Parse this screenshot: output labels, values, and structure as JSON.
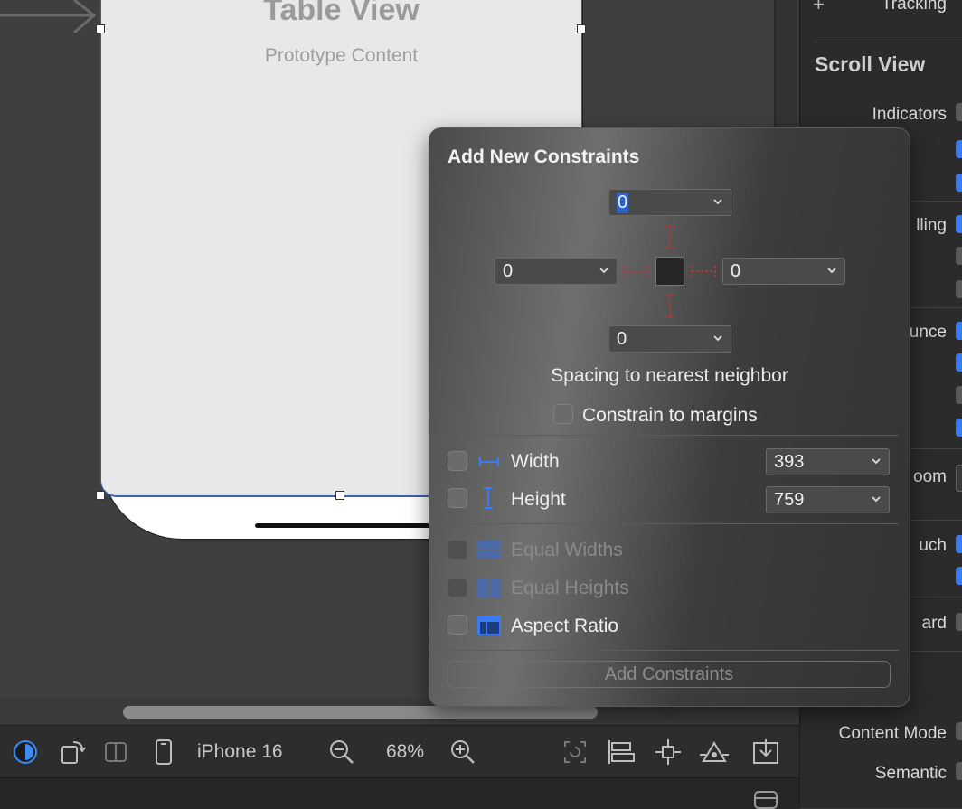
{
  "canvas": {
    "table_view_title": "Table View",
    "table_view_subtitle": "Prototype Content"
  },
  "popover": {
    "title": "Add New Constraints",
    "top_value": "0",
    "left_value": "0",
    "right_value": "0",
    "bottom_value": "0",
    "spacing_caption": "Spacing to nearest neighbor",
    "constrain_margins_label": "Constrain to margins",
    "width_label": "Width",
    "width_value": "393",
    "height_label": "Height",
    "height_value": "759",
    "equal_widths_label": "Equal Widths",
    "equal_heights_label": "Equal Heights",
    "aspect_ratio_label": "Aspect Ratio",
    "add_button_label": "Add Constraints"
  },
  "toolbar": {
    "device_name": "iPhone 16",
    "zoom_level": "68%",
    "icons": [
      "appearance-icon",
      "orientation-icon",
      "variation-icon",
      "device-icon",
      "zoom-out-icon",
      "zoom-in-icon",
      "update-frames-icon",
      "align-icon",
      "add-constraints-icon",
      "resolve-issues-icon",
      "embed-in-icon"
    ]
  },
  "inspector": {
    "top_row": "Tracking",
    "section_title": "Scroll View",
    "indicators": "Indicators",
    "scrolling": "lling",
    "bounce": "unce",
    "zoom": "oom",
    "touch": "uch",
    "keyboard": "ard",
    "content_mode": "Content Mode",
    "semantic": "Semantic"
  },
  "colors": {
    "accent": "#3a7bf2",
    "selection": "#3d5fb0",
    "constraint_red": "#c0392b"
  }
}
